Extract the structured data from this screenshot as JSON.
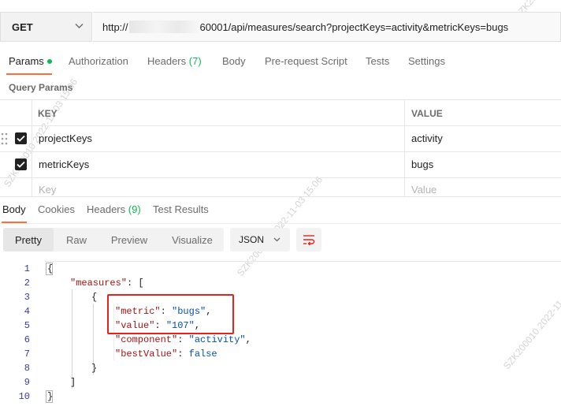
{
  "request": {
    "method": "GET",
    "url_prefix": "http://",
    "url_suffix": "60001/api/measures/search?projectKeys=activity&metricKeys=bugs"
  },
  "request_tabs": [
    {
      "label": "Params",
      "active": true
    },
    {
      "label": "Authorization"
    },
    {
      "label": "Headers",
      "count": "(7)"
    },
    {
      "label": "Body"
    },
    {
      "label": "Pre-request Script"
    },
    {
      "label": "Tests"
    },
    {
      "label": "Settings"
    }
  ],
  "query_params": {
    "title": "Query Params",
    "headers": {
      "key": "KEY",
      "value": "VALUE"
    },
    "rows": [
      {
        "key": "projectKeys",
        "value": "activity",
        "checked": true
      },
      {
        "key": "metricKeys",
        "value": "bugs",
        "checked": true
      }
    ],
    "placeholder": {
      "key": "Key",
      "value": "Value"
    }
  },
  "response_tabs": [
    {
      "label": "Body",
      "active": true
    },
    {
      "label": "Cookies"
    },
    {
      "label": "Headers",
      "count": "(9)"
    },
    {
      "label": "Test Results"
    }
  ],
  "view_modes": [
    "Pretty",
    "Raw",
    "Preview",
    "Visualize"
  ],
  "active_view": "Pretty",
  "format": "JSON",
  "code_lines": [
    "1",
    "2",
    "3",
    "4",
    "5",
    "6",
    "7",
    "8",
    "9",
    "10"
  ],
  "json_body": {
    "k_measures": "\"measures\"",
    "k_metric": "\"metric\"",
    "v_metric": "\"bugs\"",
    "k_value": "\"value\"",
    "v_value": "\"107\"",
    "k_component": "\"component\"",
    "v_component": "\"activity\"",
    "k_bestValue": "\"bestValue\"",
    "v_bestValue": "false"
  },
  "watermarks": [
    "SZK200010 2022-11-03 15:06"
  ],
  "colors": {
    "accent": "#ff6c37",
    "success": "#0cbb52",
    "highlight": "#e5231b"
  },
  "icons": [
    "chevron-down-icon",
    "checkbox-checked-icon",
    "drag-handle-icon",
    "wrap-lines-icon"
  ]
}
